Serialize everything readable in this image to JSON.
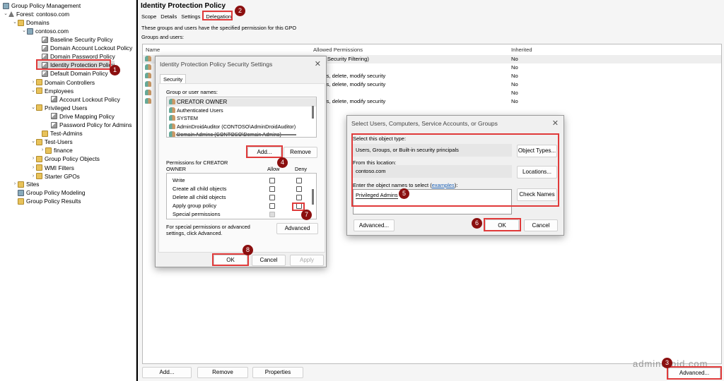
{
  "tree": {
    "root": "Group Policy Management",
    "forest": "Forest: contoso.com",
    "domains": "Domains",
    "domain": "contoso.com",
    "items": [
      {
        "label": "Baseline Security Policy",
        "type": "gpo"
      },
      {
        "label": "Domain Account Lockout Policy",
        "type": "gpo"
      },
      {
        "label": "Domain Password Policy",
        "type": "gpo"
      },
      {
        "label": "Identity Protection Policy",
        "type": "gpo",
        "selected": true
      },
      {
        "label": "Default Domain Policy",
        "type": "gpo"
      },
      {
        "label": "Domain Controllers",
        "type": "folder"
      },
      {
        "label": "Employees",
        "type": "folder"
      },
      {
        "label": "Account Lockout Policy",
        "type": "gpo"
      },
      {
        "label": "Privileged Users",
        "type": "folder"
      },
      {
        "label": "Drive Mapping Policy",
        "type": "gpo"
      },
      {
        "label": "Password Policy for Admins",
        "type": "gpo"
      },
      {
        "label": "Test-Admins",
        "type": "folder"
      },
      {
        "label": "Test-Users",
        "type": "folder"
      },
      {
        "label": "finance",
        "type": "folder"
      },
      {
        "label": "Group Policy Objects",
        "type": "folder"
      },
      {
        "label": "WMI Filters",
        "type": "folder"
      },
      {
        "label": "Starter GPOs",
        "type": "folder"
      }
    ],
    "sites": "Sites",
    "modeling": "Group Policy Modeling",
    "results": "Group Policy Results"
  },
  "main": {
    "title": "Identity Protection Policy",
    "tabs": [
      "Scope",
      "Details",
      "Settings",
      "Delegation"
    ],
    "active_tab": "Delegation",
    "description": "These groups and users have the specified permission for this GPO",
    "groups_label": "Groups and users:",
    "columns": [
      "Name",
      "Allowed Permissions",
      "Inherited"
    ],
    "rows": [
      {
        "perm": "(from Security Filtering)",
        "inherited": "No"
      },
      {
        "perm": "",
        "inherited": "No"
      },
      {
        "perm": "ettings, delete, modify security",
        "inherited": "No"
      },
      {
        "perm": "ettings, delete, modify security",
        "inherited": "No"
      },
      {
        "perm": "",
        "inherited": "No"
      },
      {
        "perm": "ettings, delete, modify security",
        "inherited": "No"
      }
    ],
    "buttons": {
      "add": "Add...",
      "remove": "Remove",
      "properties": "Properties",
      "advanced": "Advanced..."
    }
  },
  "security_dialog": {
    "title": "Identity Protection Policy Security Settings",
    "tab": "Security",
    "group_label": "Group or user names:",
    "users": [
      "CREATOR OWNER",
      "Authenticated Users",
      "SYSTEM",
      "AdminDroidAuditor (CONTOSO\\AdminDroidAuditor)",
      "Domain Admins (CONTOSO\\Domain Admins)"
    ],
    "add": "Add...",
    "remove": "Remove",
    "perm_label": "Permissions for CREATOR OWNER",
    "allow": "Allow",
    "deny": "Deny",
    "permissions": [
      "Write",
      "Create all child objects",
      "Delete all child objects",
      "Apply group policy",
      "Special permissions"
    ],
    "advanced_note": "For special permissions or advanced settings, click Advanced.",
    "advanced": "Advanced",
    "ok": "OK",
    "cancel": "Cancel",
    "apply": "Apply"
  },
  "select_dialog": {
    "title": "Select Users, Computers, Service Accounts, or Groups",
    "type_label": "Select this object type:",
    "type_value": "Users, Groups, or Built-in security principals",
    "object_types": "Object Types...",
    "location_label": "From this location:",
    "location_value": "contoso.com",
    "locations": "Locations...",
    "names_label_pre": "Enter the object names to select (",
    "names_link": "examples",
    "names_label_post": "):",
    "names_value": "Privileged Admins",
    "check_names": "Check Names",
    "advanced": "Advanced...",
    "ok": "OK",
    "cancel": "Cancel"
  },
  "annotations": [
    "1",
    "2",
    "3",
    "4",
    "5",
    "6",
    "7",
    "8"
  ],
  "watermark": "admindroid.com",
  "colors": {
    "highlight": "#e03a3a",
    "badge": "#8b0f0f",
    "link": "#1a5fb4"
  }
}
